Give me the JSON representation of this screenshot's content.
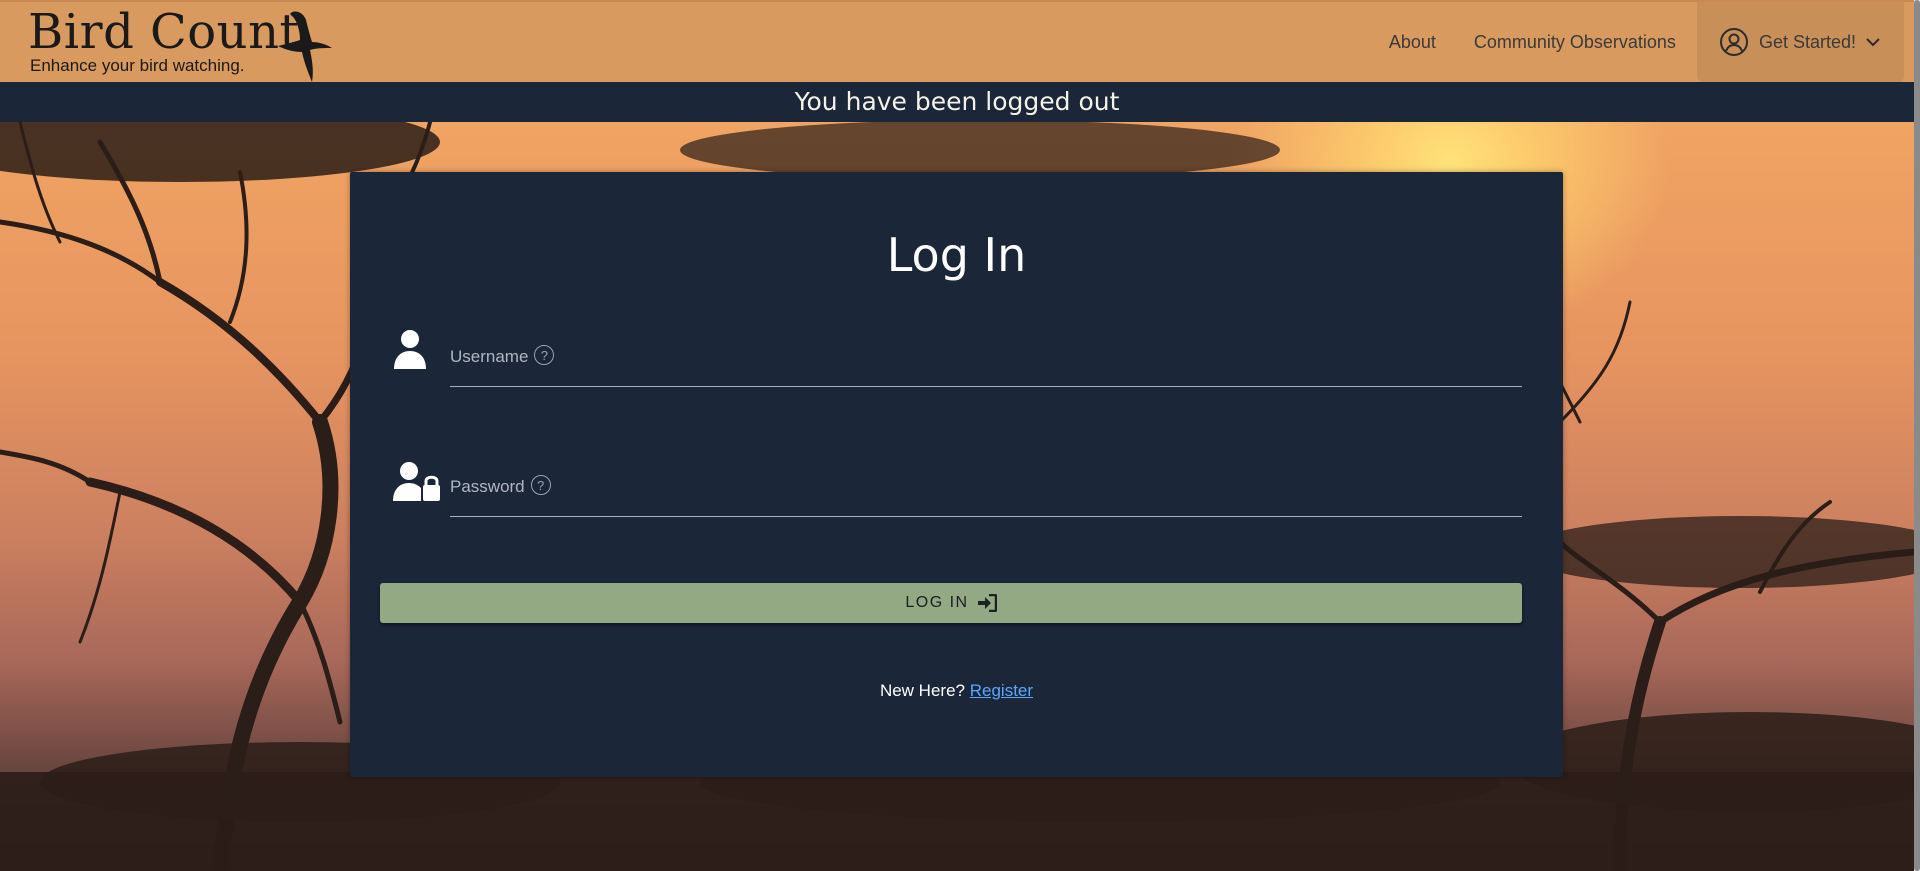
{
  "brand": {
    "title": "Bird Count",
    "tagline": "Enhance your bird watching."
  },
  "nav": {
    "items": [
      {
        "label": "About"
      },
      {
        "label": "Community Observations"
      }
    ],
    "cta_label": "Get Started!"
  },
  "notice": "You have been logged out",
  "login": {
    "title": "Log In",
    "username_label": "Username",
    "password_label": "Password",
    "help_glyph": "?",
    "button_label": "LOG IN",
    "register_prompt": "New Here?",
    "register_link": "Register"
  },
  "colors": {
    "header_bg": "#d99a5f",
    "navy": "#1b2638",
    "button_green": "#93a983",
    "link_blue": "#5aa6ff"
  },
  "icons": [
    "bird-logo-icon",
    "user-circle-icon",
    "chevron-down-icon",
    "user-icon",
    "user-lock-icon",
    "help-icon",
    "sign-in-icon"
  ]
}
